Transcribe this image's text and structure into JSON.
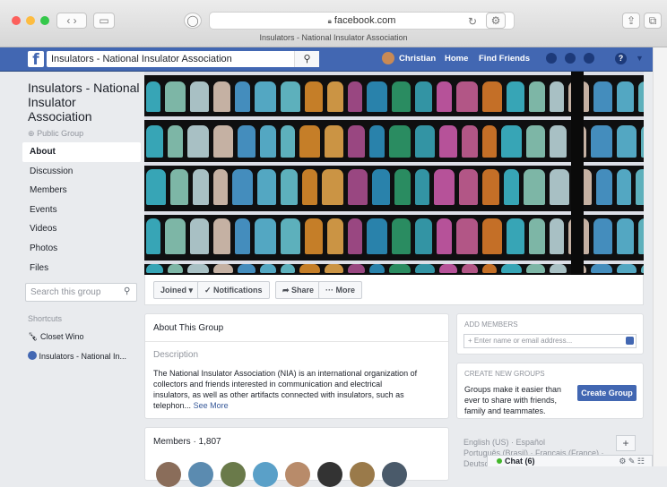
{
  "browser": {
    "url": "facebook.com",
    "tab_title": "Insulators - National Insulator Association"
  },
  "fb": {
    "search_value": "Insulators - National Insulator Association",
    "user": "Christian",
    "home": "Home",
    "find_friends": "Find Friends"
  },
  "group": {
    "name": "Insulators - National Insulator Association",
    "privacy": "Public Group",
    "nav": [
      "About",
      "Discussion",
      "Members",
      "Events",
      "Videos",
      "Photos",
      "Files"
    ],
    "search_placeholder": "Search this group",
    "shortcuts_label": "Shortcuts",
    "shortcuts": [
      "Closet Wino",
      "Insulators - National In..."
    ]
  },
  "actions": {
    "joined": "Joined ▾",
    "notifications": "✓ Notifications",
    "share": "➦ Share",
    "more": "··· More"
  },
  "about": {
    "title": "About This Group",
    "description_label": "Description",
    "description": "The National Insulator Association (NIA) is an international organization of collectors and electrical insulators, as well as other artifacts connected with insulators, such as telephon...",
    "description_lines": [
      "The National Insulator Association (NIA) is an international organization of",
      "collectors and friends interested in communication and electrical",
      "insulators, as well as other artifacts connected with insulators, such as",
      "telephon..."
    ],
    "see_more": "See More"
  },
  "members": {
    "label": "Members · 1,807"
  },
  "add_members": {
    "label": "ADD MEMBERS",
    "placeholder": "+ Enter name or email address..."
  },
  "create_group": {
    "label": "CREATE NEW GROUPS",
    "text": "Groups make it easier than ever to share with friends, family and teammates.",
    "text_lines": [
      "Groups make it easier than",
      "ever to share with friends,",
      "family and teammates."
    ],
    "button": "Create Group"
  },
  "footer": {
    "langs_line1": "English (US) · Español",
    "langs_line2": "Português (Brasil) · Français (France) ·",
    "langs_line3": "Deutsch",
    "chat": "Chat (6)",
    "plus": "+"
  }
}
